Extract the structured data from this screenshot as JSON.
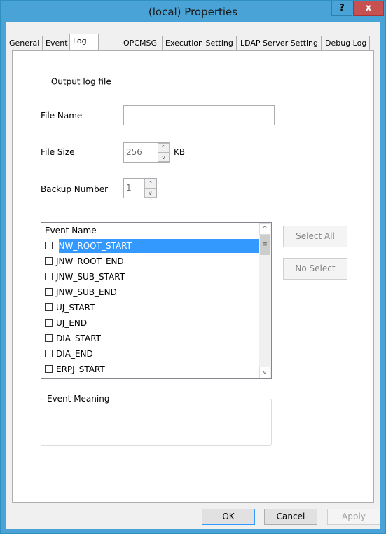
{
  "window": {
    "title": "(local) Properties",
    "help_label": "?",
    "close_label": "x"
  },
  "tabs": [
    {
      "label": "General"
    },
    {
      "label": "Event"
    },
    {
      "label": "Log"
    },
    {
      "label": "OPCMSG"
    },
    {
      "label": "Execution Setting"
    },
    {
      "label": "LDAP Server Setting"
    },
    {
      "label": "Debug Log"
    }
  ],
  "active_tab": "Log",
  "log": {
    "output_log_file_label": "Output log file",
    "output_log_file_checked": false,
    "file_name_label": "File Name",
    "file_name_value": "",
    "file_size_label": "File Size",
    "file_size_value": "256",
    "file_size_unit": "KB",
    "backup_number_label": "Backup Number",
    "backup_number_value": "1"
  },
  "event_list": {
    "header": "Event Name",
    "items": [
      {
        "label": "JNW_ROOT_START",
        "checked": false,
        "selected": true
      },
      {
        "label": "JNW_ROOT_END",
        "checked": false
      },
      {
        "label": "JNW_SUB_START",
        "checked": false
      },
      {
        "label": "JNW_SUB_END",
        "checked": false
      },
      {
        "label": "UJ_START",
        "checked": false
      },
      {
        "label": "UJ_END",
        "checked": false
      },
      {
        "label": "DIA_START",
        "checked": false
      },
      {
        "label": "DIA_END",
        "checked": false
      },
      {
        "label": "ERPJ_START",
        "checked": false
      }
    ],
    "scroll_up": "^",
    "scroll_down": "v",
    "thumb_grip": "≡"
  },
  "buttons": {
    "select_all": "Select All",
    "no_select": "No Select",
    "ok": "OK",
    "cancel": "Cancel",
    "apply": "Apply"
  },
  "event_meaning": {
    "label": "Event Meaning",
    "value": ""
  },
  "spinner": {
    "up": "^",
    "down": "v"
  }
}
